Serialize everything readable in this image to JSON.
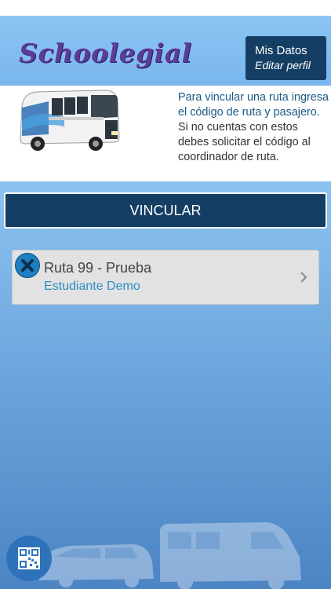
{
  "header": {
    "logo_text": "Schoolegial",
    "profile_title": "Mis Datos",
    "profile_subtitle": "Editar perfil"
  },
  "info": {
    "line_highlight": "Para vincular una ruta ingresa el código de ruta y pasajero.",
    "line_rest": "Si no cuentas con estos debes solicitar el código al coordinador de ruta."
  },
  "actions": {
    "vincular_label": "VINCULAR"
  },
  "routes": [
    {
      "name": "Ruta 99 - Prueba",
      "student": "Estudiante Demo"
    }
  ],
  "icons": {
    "remove": "close-icon",
    "chevron": "chevron-right-icon",
    "qr": "qr-code-icon",
    "bus": "bus-image",
    "vans": "vans-image"
  },
  "colors": {
    "header_bg": "#8cc5f4",
    "dark_blue": "#153e64",
    "accent_blue": "#1f7fc1",
    "link_blue": "#2a8fc6",
    "card_bg": "#e2e2e2"
  }
}
